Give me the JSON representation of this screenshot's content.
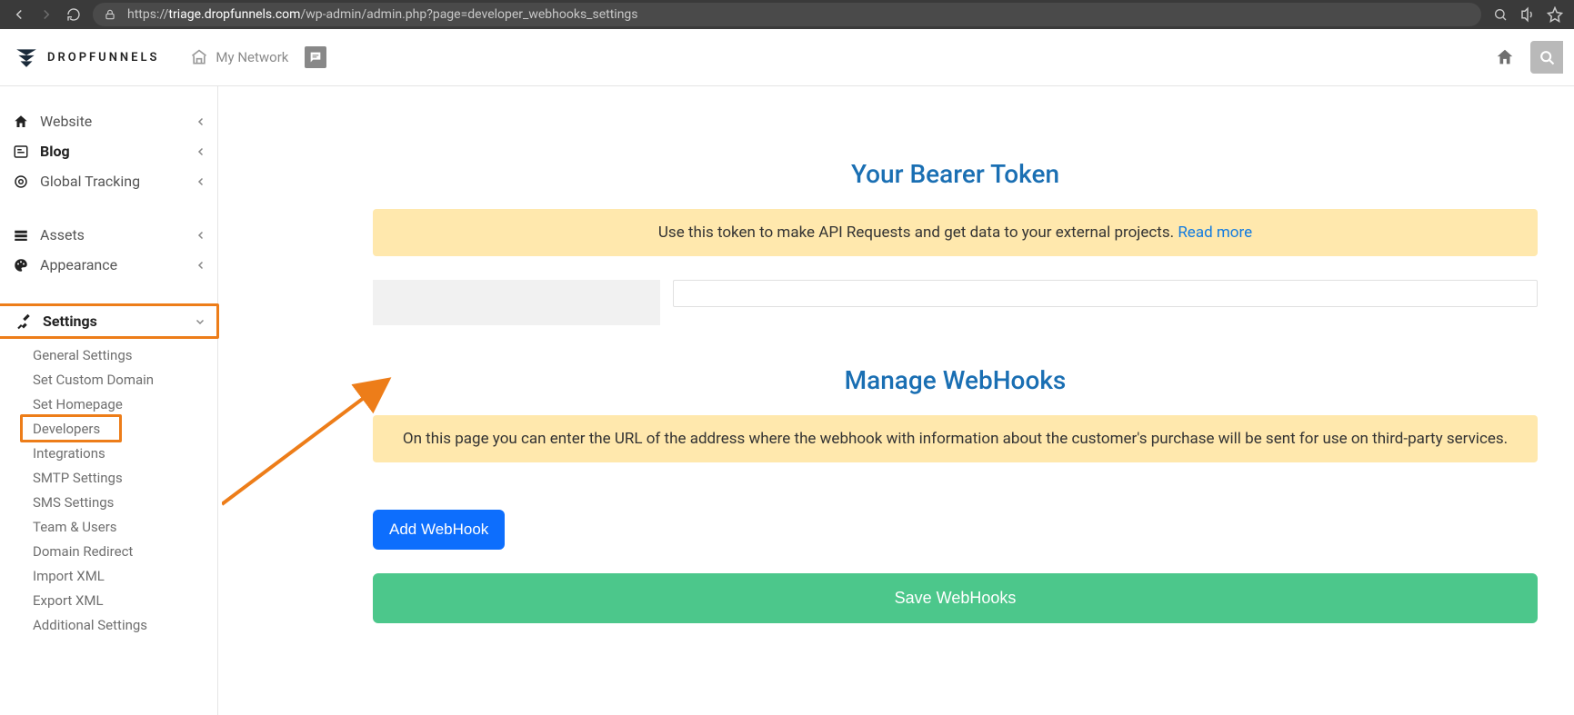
{
  "browser": {
    "url_host": "triage.dropfunnels.com",
    "url_path": "/wp-admin/admin.php?page=developer_webhooks_settings"
  },
  "appbar": {
    "brand": "DROPFUNNELS",
    "my_network": "My Network"
  },
  "sidebar": {
    "website": "Website",
    "blog": "Blog",
    "global_tracking": "Global Tracking",
    "assets": "Assets",
    "appearance": "Appearance",
    "settings": "Settings",
    "submenu": {
      "general": "General Settings",
      "custom_domain": "Set Custom Domain",
      "homepage": "Set Homepage",
      "developers": "Developers",
      "integrations": "Integrations",
      "smtp": "SMTP Settings",
      "sms": "SMS Settings",
      "team": "Team & Users",
      "redirect": "Domain Redirect",
      "import_xml": "Import XML",
      "export_xml": "Export XML",
      "additional": "Additional Settings"
    }
  },
  "content": {
    "bearer_title": "Your Bearer Token",
    "bearer_desc": "Use this token to make API Requests and get data to your external projects. ",
    "bearer_readmore": "Read more",
    "manage_title": "Manage WebHooks",
    "manage_desc": "On this page you can enter the URL of the address where the webhook with information about the customer's purchase will be sent for use on third-party services.",
    "add_webhook": "Add WebHook",
    "save_webhooks": "Save WebHooks"
  }
}
